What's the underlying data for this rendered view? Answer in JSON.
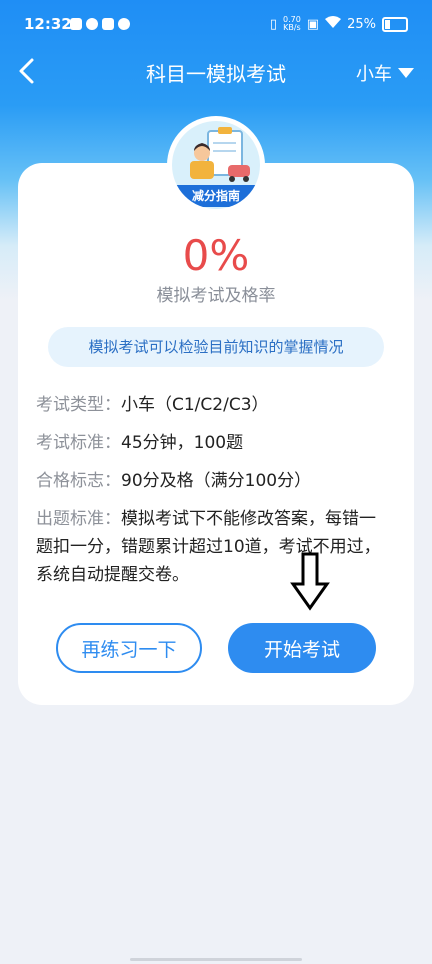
{
  "status_bar": {
    "time": "12:32",
    "net_speed_value": "0.70",
    "net_speed_unit": "KB/s",
    "battery": "25%"
  },
  "nav": {
    "title": "科目一模拟考试",
    "car_type": "小车"
  },
  "badge": {
    "label": "减分指南"
  },
  "stats": {
    "pass_rate": "0%",
    "pass_rate_label": "模拟考试及格率"
  },
  "tip": "模拟考试可以检验目前知识的掌握情况",
  "info": {
    "exam_type_key": "考试类型：",
    "exam_type_value": "小车（C1/C2/C3）",
    "standard_key": "考试标准：",
    "standard_value": "45分钟，100题",
    "pass_key": "合格标志：",
    "pass_value": "90分及格（满分100分）",
    "rule_key": "出题标准：",
    "rule_value": "模拟考试下不能修改答案，每错一题扣一分，错题累计超过10道，考试不用过，系统自动提醒交卷。"
  },
  "buttons": {
    "practice": "再练习一下",
    "start": "开始考试"
  },
  "colors": {
    "accent": "#2e8cf0",
    "pass_rate": "#e84b4b",
    "header": "#1f8ef5"
  }
}
